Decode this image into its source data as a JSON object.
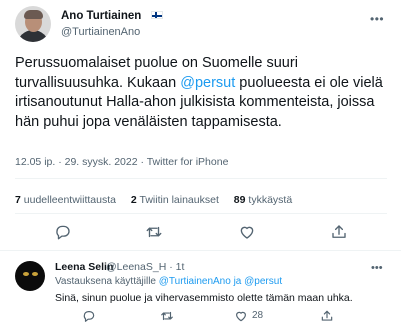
{
  "tweet": {
    "author_name": "Ano Turtiainen",
    "author_handle": "@TurtiainenAno",
    "text_before": "Perussuomalaiset puolue on Suomelle suuri turvallisuusuhka. Kukaan ",
    "mention": "@persut",
    "text_after": " puolueesta ei ole vielä irtisanoutunut Halla-ahon julkisista kommenteista, joissa hän puhui jopa venäläisten tappamisesta.",
    "timestamp": "12.05 ip. · 29. syysk. 2022 · Twitter for iPhone"
  },
  "stats": {
    "retweets_count": "7",
    "retweets_label": "uudelleentwiittausta",
    "quotes_count": "2",
    "quotes_label": "Twiitin lainaukset",
    "likes_count": "89",
    "likes_label": "tykkäystä"
  },
  "icons": {
    "more": "more-icon",
    "flag": "finland-flag-icon",
    "reply": "reply-icon",
    "retweet": "retweet-icon",
    "like": "heart-icon",
    "share": "share-icon"
  },
  "reply": {
    "author_name": "Leena Selin",
    "handle_time": "@LeenaS_H · 1t",
    "replying_to_prefix": "Vastauksena käyttäjille ",
    "replying_to_users": "@TurtiainenAno ja @persut",
    "text": "Sinä, sinun puolue ja vihervasemmisto olette tämän maan uhka.",
    "like_count": "28"
  },
  "colors": {
    "accent": "#1d9bf0",
    "text": "#0f1419",
    "muted": "#536471",
    "divider": "#eff3f4"
  }
}
